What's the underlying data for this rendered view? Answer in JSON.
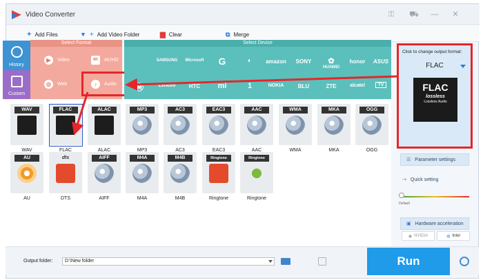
{
  "app": {
    "title": "Video Converter"
  },
  "toolbar": {
    "add_files": "Add Files",
    "add_video_folder": "Add Video Folder",
    "clear": "Clear",
    "merge": "Merge"
  },
  "format_panel": {
    "history_label": "History",
    "custom_label": "Custom",
    "select_format_header": "Select Format",
    "select_device_header": "Select Device",
    "categories": [
      {
        "label": "Video",
        "icon": "video-play-icon"
      },
      {
        "label": "4K/HD",
        "icon": "4k-icon"
      },
      {
        "label": "Web",
        "icon": "web-icon"
      },
      {
        "label": "Audio",
        "icon": "audio-icon"
      }
    ],
    "devices_row1": [
      "Apple",
      "SAMSUNG",
      "Microsoft",
      "Google",
      "LG",
      "amazon",
      "SONY",
      "HUAWEI",
      "honor",
      "ASUS"
    ],
    "devices_row2": [
      "Motorola",
      "Lenovo",
      "HTC",
      "Xiaomi",
      "OnePlus",
      "NOKIA",
      "BLU",
      "ZTE",
      "alcatel",
      "TV"
    ]
  },
  "formats": [
    {
      "tag": "WAV",
      "label": "WAV",
      "art": "black"
    },
    {
      "tag": "FLAC",
      "label": "FLAC",
      "art": "black"
    },
    {
      "tag": "ALAC",
      "label": "ALAC",
      "art": "black"
    },
    {
      "tag": "MP3",
      "label": "MP3",
      "art": "disc"
    },
    {
      "tag": "AC3",
      "label": "AC3",
      "art": "disc"
    },
    {
      "tag": "EAC3",
      "label": "EAC3",
      "art": "disc"
    },
    {
      "tag": "AAC",
      "label": "AAC",
      "art": "disc"
    },
    {
      "tag": "WMA",
      "label": "WMA",
      "art": "disc"
    },
    {
      "tag": "MKA",
      "label": "MKA",
      "art": "disc"
    },
    {
      "tag": "OGG",
      "label": "OGG",
      "art": "disc"
    },
    {
      "tag": "AU",
      "label": "AU",
      "art": "orange"
    },
    {
      "tag": "dts",
      "label": "DTS",
      "art": "red"
    },
    {
      "tag": "AIFF",
      "label": "AIFF",
      "art": "disc"
    },
    {
      "tag": "M4A",
      "label": "M4A",
      "art": "disc"
    },
    {
      "tag": "M4B",
      "label": "M4B",
      "art": "disc"
    },
    {
      "tag": "Ringtone",
      "label": "Ringtone",
      "art": "red"
    },
    {
      "tag": "Ringtone",
      "label": "Ringtone",
      "art": "android"
    }
  ],
  "output_panel": {
    "hint": "Click to change output format:",
    "selected_format": "FLAC",
    "tile_big": "FLAC",
    "tile_lossless": "lossless",
    "tile_sub": "Lossless Audio",
    "parameter_settings": "Parameter settings",
    "quick_setting": "Quick setting",
    "default_label": "Default",
    "hardware_acceleration": "Hardware acceleration",
    "nvidia": "NVIDIA",
    "intel": "Intel"
  },
  "bottom": {
    "output_folder_label": "Output folder:",
    "output_folder_value": "D:\\New folder",
    "run": "Run"
  },
  "colors": {
    "annotation_red": "#e5262a",
    "format_panel": "#f3a99d",
    "device_panel": "#5bbfbc",
    "run_button": "#1f9be9",
    "selected_outline": "#2d56c9"
  }
}
